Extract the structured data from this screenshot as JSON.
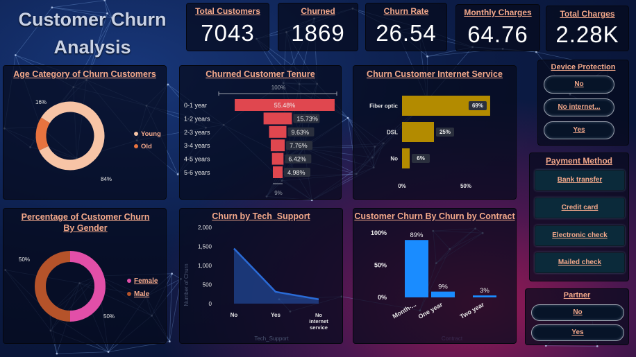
{
  "title": "Customer  Churn Analysis",
  "kpis": [
    {
      "label": "Total Customers",
      "value": "7043"
    },
    {
      "label": "Churned",
      "value": "1869"
    },
    {
      "label": "Churn Rate",
      "value": "26.54"
    },
    {
      "label": "Monthly Charges",
      "value": "64.76"
    },
    {
      "label": "Total Charges",
      "value": "2.28K"
    }
  ],
  "colors": {
    "accent": "#f4a98b",
    "young": "#f7c4a6",
    "old": "#e8733f",
    "female": "#e24fa8",
    "male": "#b5532a",
    "funnel": "#e0474f",
    "internet": "#b38b00",
    "tech": "#2a6bd6",
    "contract": "#1a8cff"
  },
  "slicers": {
    "device_protection": {
      "title": "Device Protection",
      "items": [
        "No",
        "No internet...",
        "Yes"
      ]
    },
    "payment_method": {
      "title": "Payment Method",
      "items": [
        "Bank transfer",
        "Credit card",
        "Electronic check",
        "Mailed check"
      ]
    },
    "partner": {
      "title": "Partner",
      "items": [
        "No",
        "Yes"
      ]
    }
  },
  "chart_data": [
    {
      "type": "pie",
      "title": "Age Category of Churn Customers",
      "labels": [
        "Young",
        "Old"
      ],
      "values": [
        84,
        16
      ],
      "data_labels": [
        "84%",
        "16%"
      ],
      "legend": "right"
    },
    {
      "type": "bar",
      "title": "Churned Customer Tenure",
      "orientation": "horizontal funnel",
      "categories": [
        "0-1 year",
        "1-2 years",
        "2-3 years",
        "3-4 years",
        "4-5 years",
        "5-6 years"
      ],
      "values": [
        55.48,
        15.73,
        9.63,
        7.76,
        6.42,
        4.98
      ],
      "data_labels": [
        "55.48%",
        "15.73%",
        "9.63%",
        "7.76%",
        "6.42%",
        "4.98%"
      ],
      "top_label": "100%",
      "bottom_label": "9%"
    },
    {
      "type": "bar",
      "title": "Churn Customer Internet Service",
      "orientation": "horizontal",
      "categories": [
        "Fiber optic",
        "DSL",
        "No"
      ],
      "values": [
        69,
        25,
        6
      ],
      "data_labels": [
        "69%",
        "25%",
        "6%"
      ],
      "xticks": [
        "0%",
        "50%"
      ],
      "xlim": [
        0,
        80
      ]
    },
    {
      "type": "pie",
      "title": "Percentage of Customer Churn By Gender",
      "labels": [
        "Female",
        "Male"
      ],
      "values": [
        50,
        50
      ],
      "data_labels": [
        "50%",
        "50%"
      ],
      "legend": "right"
    },
    {
      "type": "area",
      "title": "Churn by Tech_Support",
      "categories": [
        "No",
        "Yes",
        "No internet service"
      ],
      "values": [
        1446,
        310,
        113
      ],
      "yticks": [
        "0",
        "500",
        "1,000",
        "1,500",
        "2,000"
      ],
      "ylim": [
        0,
        2000
      ],
      "ylabel": "Number of Churn",
      "xlabel": "Tech_Support"
    },
    {
      "type": "bar",
      "title": "Customer Churn By Churn by Contract",
      "categories": [
        "Month-...",
        "One year",
        "Two year"
      ],
      "values": [
        89,
        9,
        3
      ],
      "data_labels": [
        "89%",
        "9%",
        "3%"
      ],
      "yticks": [
        "0%",
        "50%",
        "100%"
      ],
      "ylim": [
        0,
        100
      ],
      "xlabel": "Contract"
    }
  ]
}
